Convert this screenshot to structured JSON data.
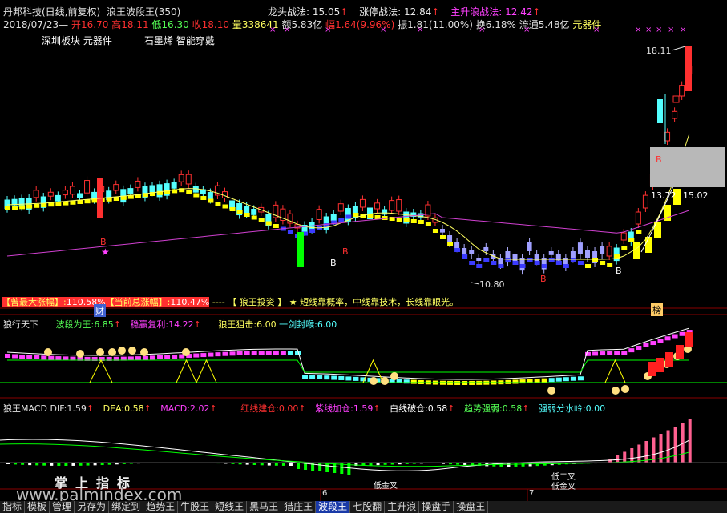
{
  "header": {
    "title_left": "丹邦科技(日线,前复权)",
    "title_right": "浪王波段王(350)",
    "lt_label": "龙头战法:",
    "lt_value": "15.05",
    "zt_label": "涨停战法:",
    "zt_value": "12.84",
    "zs_label": "主升浪战法:",
    "zs_value": "12.42",
    "date": "2018/07/23",
    "open_label": "开",
    "open": "16.70",
    "high_label": "高",
    "high": "18.11",
    "low_label": "低",
    "low": "16.30",
    "close_label": "收",
    "close": "18.10",
    "vol_label": "量",
    "vol": "338641",
    "amt_label": "额",
    "amt": "5.83亿",
    "chg_label": "幅",
    "chg": "1.64(9.96%)",
    "amp_label": "振",
    "amp": "1.81(11.00%)",
    "turn_label": "换",
    "turn": "6.18%",
    "float_label": "流通",
    "float": "5.48亿",
    "sector": "元器件",
    "tags1": "深圳板块  元器件",
    "tags2": "石墨烯 智能穿戴"
  },
  "price_panel": {
    "high_marker": "18.11",
    "low_marker": "10.80",
    "box_left": "13.72",
    "box_right": "15.02",
    "banner_max_label": "【曾最大涨幅】:",
    "banner_max_value": "110.58%",
    "banner_cur_label": "【当前总涨幅】:",
    "banner_cur_value": "110.47%",
    "banner_sep": "----",
    "banner_title": "【 狼王投资 】",
    "banner_motto": "★ 短线靠概率，中线靠技术，长线靠眼光。",
    "cai_label": "财",
    "bang_label": "榜",
    "b_label": "B",
    "star": "★"
  },
  "mid_panel": {
    "name": "狼行天下",
    "s1_label": "波段为王:",
    "s1_value": "6.85",
    "s2_label": "稳赢复利:",
    "s2_value": "14.22",
    "s3_label": "狼王狙击:",
    "s3_value": "6.00",
    "s4_label": "一剑封喉:",
    "s4_value": "6.00"
  },
  "macd_panel": {
    "name": "狼王MACD",
    "dif_label": "DIF:",
    "dif": "1.59",
    "dea_label": "DEA:",
    "dea": "0.58",
    "macd_label": "MACD:",
    "macd": "2.02",
    "red_label": "红线建仓:",
    "red": "0.00",
    "purple_label": "紫线加仓:",
    "purple": "1.59",
    "white_label": "白线破仓:",
    "white": "0.58",
    "trend_label": "趋势强弱:",
    "trend": "0.58",
    "strong_label": "强弱分水岭:",
    "strong": "0.00",
    "month6": "6",
    "month7": "7",
    "lowgold1": "低金叉",
    "lowgold2": "低二叉",
    "lowgold3": "低金叉"
  },
  "watermark": {
    "text1": "掌上指标",
    "text2": "www.palmindex.com"
  },
  "tabs": [
    "指标",
    "模板",
    "管理",
    "另存为",
    "绑定到",
    "趋势王",
    "牛股王",
    "短线王",
    "黑马王",
    "猎庄王",
    "波段王",
    "七股翻",
    "主升浪",
    "操盘手",
    "操盘王"
  ],
  "active_tab": "波段王",
  "colors": {
    "up": "#ff3030",
    "down": "#54ffff",
    "ma1": "#ffff60",
    "ma2": "#d040d0",
    "blue": "#3b3bff",
    "yellow": "#ffff00",
    "green": "#00ff00"
  }
}
